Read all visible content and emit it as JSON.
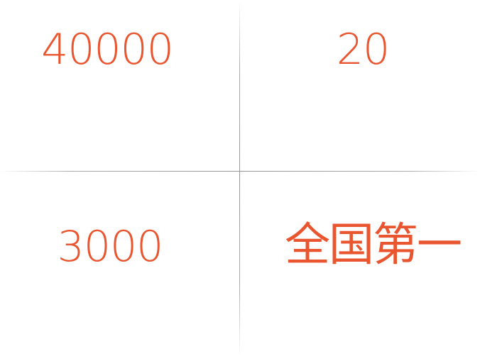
{
  "stats": {
    "top_left": "40000",
    "top_right": "20",
    "bottom_left": "3000",
    "bottom_right": "全国第一"
  },
  "colors": {
    "accent": "#e8552f",
    "divider": "#9a9a9a",
    "background": "#ffffff"
  }
}
